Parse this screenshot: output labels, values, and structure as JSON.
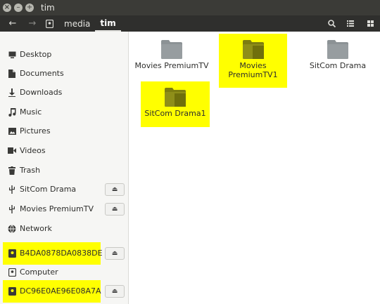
{
  "window": {
    "title": "tim"
  },
  "breadcrumb": [
    {
      "label": "media"
    },
    {
      "label": "tim"
    }
  ],
  "sidebar": {
    "items": [
      {
        "label": "Desktop",
        "icon": "desktop-icon"
      },
      {
        "label": "Documents",
        "icon": "documents-icon"
      },
      {
        "label": "Downloads",
        "icon": "downloads-icon"
      },
      {
        "label": "Music",
        "icon": "music-icon"
      },
      {
        "label": "Pictures",
        "icon": "pictures-icon"
      },
      {
        "label": "Videos",
        "icon": "videos-icon"
      },
      {
        "label": "Trash",
        "icon": "trash-icon"
      },
      {
        "label": "SitCom Drama",
        "icon": "usb-icon",
        "eject": true
      },
      {
        "label": "Movies PremiumTV",
        "icon": "usb-icon",
        "eject": true
      },
      {
        "label": "Network",
        "icon": "network-icon"
      },
      {
        "label": "B4DA0878DA0838DE",
        "icon": "drive-icon",
        "eject": true,
        "highlighted": true
      },
      {
        "label": "Computer",
        "icon": "computer-icon"
      },
      {
        "label": "DC96E0AE96E08A7A",
        "icon": "drive-icon",
        "eject": true,
        "highlighted": true
      }
    ]
  },
  "folders": [
    {
      "label": "Movies PremiumTV",
      "highlighted": false
    },
    {
      "label": "Movies PremiumTV1",
      "highlighted": true
    },
    {
      "label": "SitCom Drama",
      "highlighted": false
    },
    {
      "label": "SitCom Drama1",
      "highlighted": true
    }
  ],
  "colors": {
    "highlight": "#ffff00",
    "folder": "#8c9295",
    "folder_highlighted": "#8e8e19",
    "titlebar": "#3b3b37",
    "toolbar": "#2f2f2d"
  }
}
